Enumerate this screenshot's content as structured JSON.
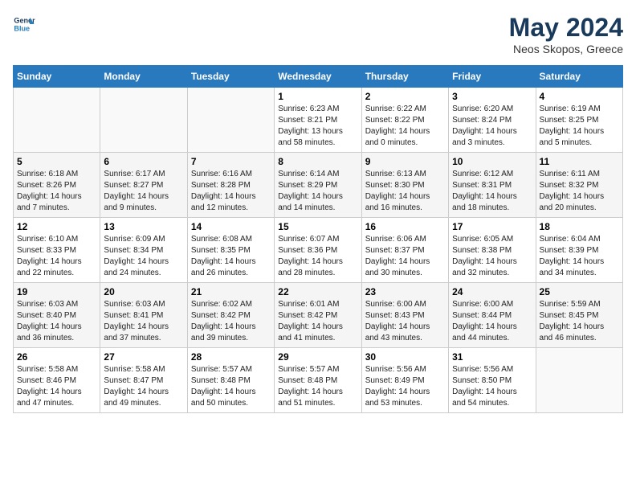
{
  "header": {
    "logo_line1": "General",
    "logo_line2": "Blue",
    "month_year": "May 2024",
    "location": "Neos Skopos, Greece"
  },
  "weekdays": [
    "Sunday",
    "Monday",
    "Tuesday",
    "Wednesday",
    "Thursday",
    "Friday",
    "Saturday"
  ],
  "weeks": [
    [
      {
        "day": "",
        "sunrise": "",
        "sunset": "",
        "daylight": ""
      },
      {
        "day": "",
        "sunrise": "",
        "sunset": "",
        "daylight": ""
      },
      {
        "day": "",
        "sunrise": "",
        "sunset": "",
        "daylight": ""
      },
      {
        "day": "1",
        "sunrise": "Sunrise: 6:23 AM",
        "sunset": "Sunset: 8:21 PM",
        "daylight": "Daylight: 13 hours and 58 minutes."
      },
      {
        "day": "2",
        "sunrise": "Sunrise: 6:22 AM",
        "sunset": "Sunset: 8:22 PM",
        "daylight": "Daylight: 14 hours and 0 minutes."
      },
      {
        "day": "3",
        "sunrise": "Sunrise: 6:20 AM",
        "sunset": "Sunset: 8:24 PM",
        "daylight": "Daylight: 14 hours and 3 minutes."
      },
      {
        "day": "4",
        "sunrise": "Sunrise: 6:19 AM",
        "sunset": "Sunset: 8:25 PM",
        "daylight": "Daylight: 14 hours and 5 minutes."
      }
    ],
    [
      {
        "day": "5",
        "sunrise": "Sunrise: 6:18 AM",
        "sunset": "Sunset: 8:26 PM",
        "daylight": "Daylight: 14 hours and 7 minutes."
      },
      {
        "day": "6",
        "sunrise": "Sunrise: 6:17 AM",
        "sunset": "Sunset: 8:27 PM",
        "daylight": "Daylight: 14 hours and 9 minutes."
      },
      {
        "day": "7",
        "sunrise": "Sunrise: 6:16 AM",
        "sunset": "Sunset: 8:28 PM",
        "daylight": "Daylight: 14 hours and 12 minutes."
      },
      {
        "day": "8",
        "sunrise": "Sunrise: 6:14 AM",
        "sunset": "Sunset: 8:29 PM",
        "daylight": "Daylight: 14 hours and 14 minutes."
      },
      {
        "day": "9",
        "sunrise": "Sunrise: 6:13 AM",
        "sunset": "Sunset: 8:30 PM",
        "daylight": "Daylight: 14 hours and 16 minutes."
      },
      {
        "day": "10",
        "sunrise": "Sunrise: 6:12 AM",
        "sunset": "Sunset: 8:31 PM",
        "daylight": "Daylight: 14 hours and 18 minutes."
      },
      {
        "day": "11",
        "sunrise": "Sunrise: 6:11 AM",
        "sunset": "Sunset: 8:32 PM",
        "daylight": "Daylight: 14 hours and 20 minutes."
      }
    ],
    [
      {
        "day": "12",
        "sunrise": "Sunrise: 6:10 AM",
        "sunset": "Sunset: 8:33 PM",
        "daylight": "Daylight: 14 hours and 22 minutes."
      },
      {
        "day": "13",
        "sunrise": "Sunrise: 6:09 AM",
        "sunset": "Sunset: 8:34 PM",
        "daylight": "Daylight: 14 hours and 24 minutes."
      },
      {
        "day": "14",
        "sunrise": "Sunrise: 6:08 AM",
        "sunset": "Sunset: 8:35 PM",
        "daylight": "Daylight: 14 hours and 26 minutes."
      },
      {
        "day": "15",
        "sunrise": "Sunrise: 6:07 AM",
        "sunset": "Sunset: 8:36 PM",
        "daylight": "Daylight: 14 hours and 28 minutes."
      },
      {
        "day": "16",
        "sunrise": "Sunrise: 6:06 AM",
        "sunset": "Sunset: 8:37 PM",
        "daylight": "Daylight: 14 hours and 30 minutes."
      },
      {
        "day": "17",
        "sunrise": "Sunrise: 6:05 AM",
        "sunset": "Sunset: 8:38 PM",
        "daylight": "Daylight: 14 hours and 32 minutes."
      },
      {
        "day": "18",
        "sunrise": "Sunrise: 6:04 AM",
        "sunset": "Sunset: 8:39 PM",
        "daylight": "Daylight: 14 hours and 34 minutes."
      }
    ],
    [
      {
        "day": "19",
        "sunrise": "Sunrise: 6:03 AM",
        "sunset": "Sunset: 8:40 PM",
        "daylight": "Daylight: 14 hours and 36 minutes."
      },
      {
        "day": "20",
        "sunrise": "Sunrise: 6:03 AM",
        "sunset": "Sunset: 8:41 PM",
        "daylight": "Daylight: 14 hours and 37 minutes."
      },
      {
        "day": "21",
        "sunrise": "Sunrise: 6:02 AM",
        "sunset": "Sunset: 8:42 PM",
        "daylight": "Daylight: 14 hours and 39 minutes."
      },
      {
        "day": "22",
        "sunrise": "Sunrise: 6:01 AM",
        "sunset": "Sunset: 8:42 PM",
        "daylight": "Daylight: 14 hours and 41 minutes."
      },
      {
        "day": "23",
        "sunrise": "Sunrise: 6:00 AM",
        "sunset": "Sunset: 8:43 PM",
        "daylight": "Daylight: 14 hours and 43 minutes."
      },
      {
        "day": "24",
        "sunrise": "Sunrise: 6:00 AM",
        "sunset": "Sunset: 8:44 PM",
        "daylight": "Daylight: 14 hours and 44 minutes."
      },
      {
        "day": "25",
        "sunrise": "Sunrise: 5:59 AM",
        "sunset": "Sunset: 8:45 PM",
        "daylight": "Daylight: 14 hours and 46 minutes."
      }
    ],
    [
      {
        "day": "26",
        "sunrise": "Sunrise: 5:58 AM",
        "sunset": "Sunset: 8:46 PM",
        "daylight": "Daylight: 14 hours and 47 minutes."
      },
      {
        "day": "27",
        "sunrise": "Sunrise: 5:58 AM",
        "sunset": "Sunset: 8:47 PM",
        "daylight": "Daylight: 14 hours and 49 minutes."
      },
      {
        "day": "28",
        "sunrise": "Sunrise: 5:57 AM",
        "sunset": "Sunset: 8:48 PM",
        "daylight": "Daylight: 14 hours and 50 minutes."
      },
      {
        "day": "29",
        "sunrise": "Sunrise: 5:57 AM",
        "sunset": "Sunset: 8:48 PM",
        "daylight": "Daylight: 14 hours and 51 minutes."
      },
      {
        "day": "30",
        "sunrise": "Sunrise: 5:56 AM",
        "sunset": "Sunset: 8:49 PM",
        "daylight": "Daylight: 14 hours and 53 minutes."
      },
      {
        "day": "31",
        "sunrise": "Sunrise: 5:56 AM",
        "sunset": "Sunset: 8:50 PM",
        "daylight": "Daylight: 14 hours and 54 minutes."
      },
      {
        "day": "",
        "sunrise": "",
        "sunset": "",
        "daylight": ""
      }
    ]
  ]
}
